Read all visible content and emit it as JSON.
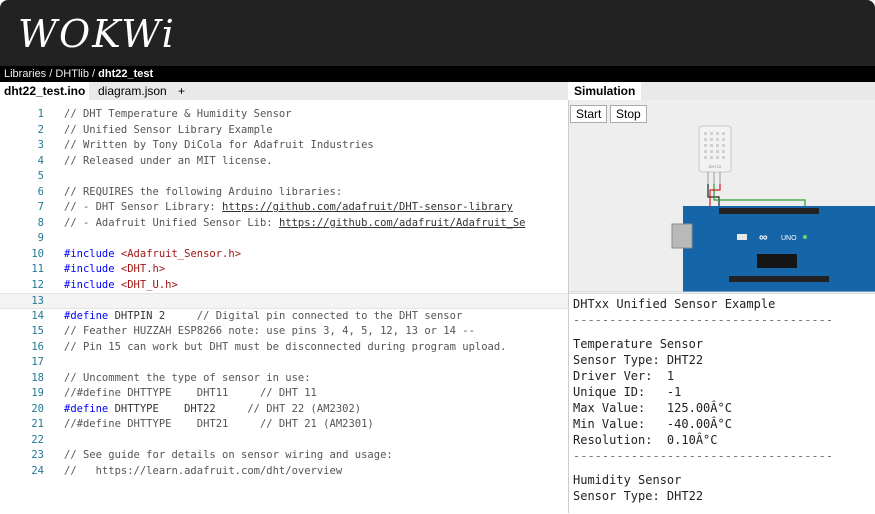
{
  "app": {
    "logo": "WOKWi"
  },
  "breadcrumb": {
    "path": "Libraries / DHTlib / ",
    "current": "dht22_test"
  },
  "editor_tabs": [
    {
      "label": "dht22_test.ino"
    },
    {
      "label": "diagram.json"
    },
    {
      "label": "+"
    }
  ],
  "sim_tab": {
    "label": "Simulation"
  },
  "buttons": {
    "start": "Start",
    "stop": "Stop"
  },
  "colors": {
    "header": "#222222",
    "board": "#1565a8",
    "line_numbers": "#237893",
    "keyword": "#0000ff",
    "string": "#a31515"
  },
  "code_lines": [
    {
      "n": "1",
      "segs": [
        {
          "t": "// DHT Temperature & Humidity Sensor",
          "c": "cmt"
        }
      ]
    },
    {
      "n": "2",
      "segs": [
        {
          "t": "// Unified Sensor Library Example",
          "c": "cmt"
        }
      ]
    },
    {
      "n": "3",
      "segs": [
        {
          "t": "// Written by Tony DiCola for Adafruit Industries",
          "c": "cmt"
        }
      ]
    },
    {
      "n": "4",
      "segs": [
        {
          "t": "// Released under an MIT license.",
          "c": "cmt"
        }
      ]
    },
    {
      "n": "5",
      "segs": []
    },
    {
      "n": "6",
      "segs": [
        {
          "t": "// REQUIRES the following Arduino libraries:",
          "c": "cmt"
        }
      ]
    },
    {
      "n": "7",
      "segs": [
        {
          "t": "// - DHT Sensor Library: ",
          "c": "cmt"
        },
        {
          "t": "https://github.com/adafruit/DHT-sensor-library",
          "c": "lnk"
        }
      ]
    },
    {
      "n": "8",
      "segs": [
        {
          "t": "// - Adafruit Unified Sensor Lib: ",
          "c": "cmt"
        },
        {
          "t": "https://github.com/adafruit/Adafruit_Se",
          "c": "lnk"
        }
      ]
    },
    {
      "n": "9",
      "segs": []
    },
    {
      "n": "10",
      "segs": [
        {
          "t": "#include ",
          "c": "kw"
        },
        {
          "t": "<Adafruit_Sensor.h>",
          "c": "str"
        }
      ]
    },
    {
      "n": "11",
      "segs": [
        {
          "t": "#include ",
          "c": "kw"
        },
        {
          "t": "<DHT.h>",
          "c": "str"
        }
      ]
    },
    {
      "n": "12",
      "segs": [
        {
          "t": "#include ",
          "c": "kw"
        },
        {
          "t": "<DHT_U.h>",
          "c": "str"
        }
      ]
    },
    {
      "n": "13",
      "segs": []
    },
    {
      "n": "14",
      "segs": [
        {
          "t": "#define ",
          "c": "kw"
        },
        {
          "t": "DHTPIN 2",
          "c": ""
        },
        {
          "t": "     // Digital pin connected to the DHT sensor",
          "c": "cmt"
        }
      ]
    },
    {
      "n": "15",
      "segs": [
        {
          "t": "// Feather HUZZAH ESP8266 note: use pins 3, 4, 5, 12, 13 or 14 --",
          "c": "cmt"
        }
      ]
    },
    {
      "n": "16",
      "segs": [
        {
          "t": "// Pin 15 can work but DHT must be disconnected during program upload.",
          "c": "cmt"
        }
      ]
    },
    {
      "n": "17",
      "segs": []
    },
    {
      "n": "18",
      "segs": [
        {
          "t": "// Uncomment the type of sensor in use:",
          "c": "cmt"
        }
      ]
    },
    {
      "n": "19",
      "segs": [
        {
          "t": "//#define DHTTYPE    DHT11     // DHT 11",
          "c": "cmt"
        }
      ]
    },
    {
      "n": "20",
      "segs": [
        {
          "t": "#define ",
          "c": "kw"
        },
        {
          "t": "DHTTYPE    DHT22",
          "c": ""
        },
        {
          "t": "     // DHT 22 (AM2302)",
          "c": "cmt"
        }
      ]
    },
    {
      "n": "21",
      "segs": [
        {
          "t": "//#define DHTTYPE    DHT21     // DHT 21 (AM2301)",
          "c": "cmt"
        }
      ]
    },
    {
      "n": "22",
      "segs": []
    },
    {
      "n": "23",
      "segs": [
        {
          "t": "// See guide for details on sensor wiring and usage:",
          "c": "cmt"
        }
      ]
    },
    {
      "n": "24",
      "segs": [
        {
          "t": "//   https://learn.adafruit.com/dht/overview",
          "c": "cmt"
        }
      ]
    }
  ],
  "serial_output": [
    "DHTxx Unified Sensor Example",
    "------------------------------------",
    "Temperature Sensor",
    "Sensor Type: DHT22",
    "Driver Ver:  1",
    "Unique ID:   -1",
    "Max Value:   125.00Â°C",
    "Min Value:   -40.00Â°C",
    "Resolution:  0.10Â°C",
    "------------------------------------",
    "Humidity Sensor",
    "Sensor Type: DHT22"
  ],
  "sensor_label": "DHT22",
  "board_label": "UNO"
}
